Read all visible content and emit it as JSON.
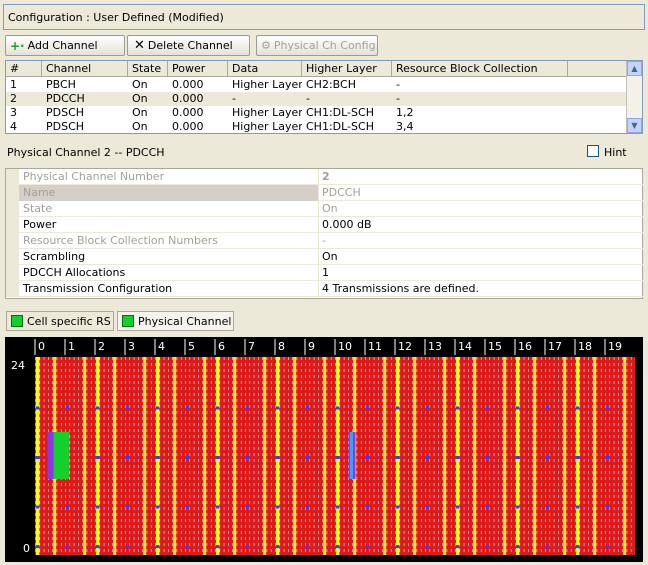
{
  "config": {
    "label": "Configuration : User Defined (Modified)"
  },
  "toolbar": {
    "add_label": "Add Channel",
    "delete_label": "Delete Channel",
    "config_label": "Physical Ch Config."
  },
  "table": {
    "headers": [
      "#",
      "Channel",
      "State",
      "Power",
      "Data",
      "Higher Layer",
      "Resource Block Collection"
    ],
    "rows": [
      {
        "num": "1",
        "channel": "PBCH",
        "state": "On",
        "power": "0.000",
        "data": "Higher Layer",
        "higher": "CH2:BCH",
        "rbc": "-"
      },
      {
        "num": "2",
        "channel": "PDCCH",
        "state": "On",
        "power": "0.000",
        "data": "-",
        "higher": "-",
        "rbc": "-"
      },
      {
        "num": "3",
        "channel": "PDSCH",
        "state": "On",
        "power": "0.000",
        "data": "Higher Layer",
        "higher": "CH1:DL-SCH",
        "rbc": "1,2"
      },
      {
        "num": "4",
        "channel": "PDSCH",
        "state": "On",
        "power": "0.000",
        "data": "Higher Layer",
        "higher": "CH1:DL-SCH",
        "rbc": "3,4"
      }
    ]
  },
  "physical": {
    "title": "Physical Channel 2 -- PDCCH",
    "hint_label": "Hint",
    "props": [
      {
        "name": "Physical Channel Number",
        "value": "2"
      },
      {
        "name": "Name",
        "value": "PDCCH"
      },
      {
        "name": "State",
        "value": "On"
      },
      {
        "name": "Power",
        "value": "0.000 dB"
      },
      {
        "name": "Resource Block Collection Numbers",
        "value": "-"
      },
      {
        "name": "Scrambling",
        "value": "On"
      },
      {
        "name": "PDCCH Allocations",
        "value": "1"
      },
      {
        "name": "Transmission Configuration",
        "value": "4 Transmissions are defined."
      }
    ]
  },
  "legend": {
    "rs_label": "Cell specific RS",
    "phys_label": "Physical Channel"
  },
  "resource_grid": {
    "slot_labels": [
      "0",
      "1",
      "2",
      "3",
      "4",
      "5",
      "6",
      "7",
      "8",
      "9",
      "10",
      "11",
      "12",
      "13",
      "14",
      "15",
      "16",
      "17",
      "18",
      "19"
    ],
    "y_top_label": "24",
    "y_bottom_label": "0",
    "colors": {
      "background": "#dc1a1a",
      "rs": "#f5f530",
      "pilot": "#3a3aff",
      "phys": "#15d02c",
      "phys_edge": "#8a38e8"
    }
  }
}
